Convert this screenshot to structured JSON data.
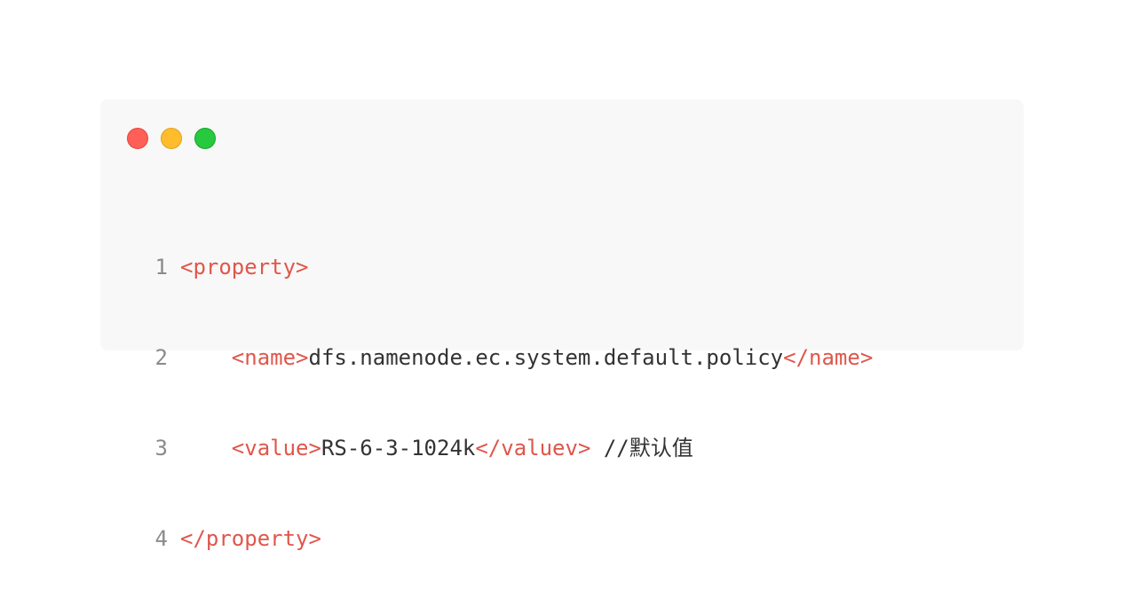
{
  "window": {
    "controls": {
      "close": "close-dot",
      "minimize": "minimize-dot",
      "maximize": "maximize-dot"
    }
  },
  "code": {
    "lines": [
      {
        "number": "1",
        "indent": "",
        "open": "<property>",
        "text": "",
        "close": "",
        "comment": ""
      },
      {
        "number": "2",
        "indent": "    ",
        "open": "<name>",
        "text": "dfs.namenode.ec.system.default.policy",
        "close": "</name>",
        "comment": ""
      },
      {
        "number": "3",
        "indent": "    ",
        "open": "<value>",
        "text": "RS-6-3-1024k",
        "close": "</valuev>",
        "comment": " //默认值"
      },
      {
        "number": "4",
        "indent": "",
        "open": "</property>",
        "text": "",
        "close": "",
        "comment": ""
      }
    ]
  },
  "colors": {
    "tag": "#e0564b",
    "text": "#333333",
    "line_number": "#8a8a8a",
    "background": "#f8f8f8"
  }
}
